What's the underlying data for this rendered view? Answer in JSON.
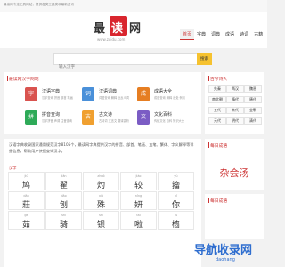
{
  "topbar": {
    "text": "最读网专注工具网站，提供各类工具类和最新资讯"
  },
  "logo": {
    "part1": "最",
    "part2": "读",
    "part3": "网",
    "url": "www.zuidu.com"
  },
  "nav": [
    "首页",
    "字典",
    "词典",
    "成语",
    "诗词",
    "古籍"
  ],
  "search": {
    "placeholder": "输入汉字",
    "button": "搜索"
  },
  "tools_panel": {
    "title": "最读网汉字网站",
    "items": [
      {
        "icon": "字",
        "name": "汉语字典",
        "desc": "汉字查询 拼音 部首 笔画",
        "color": "#d9534f"
      },
      {
        "icon": "词",
        "name": "汉语词典",
        "desc": "词语查询 解释 近反义词",
        "color": "#4a90d9"
      },
      {
        "icon": "成",
        "name": "成语大全",
        "desc": "成语查询 解释 出处 例句",
        "color": "#e67e22"
      },
      {
        "icon": "拼",
        "name": "拼音查询",
        "desc": "汉字拼音 声调 注音查询",
        "color": "#2eaa58"
      },
      {
        "icon": "古",
        "name": "古文诗",
        "desc": "古诗词 文言文 翻译赏析",
        "color": "#f0a030"
      },
      {
        "icon": "文",
        "name": "文化百科",
        "desc": "传统文化 百科 知识大全",
        "color": "#7b5cc4"
      }
    ]
  },
  "dynasty_panel": {
    "title": "古今诗人",
    "items": [
      "先秦",
      "两汉",
      "魏晋",
      "南北朝",
      "隋代",
      "唐代",
      "五代",
      "宋代",
      "金朝",
      "元代",
      "明代",
      "清代"
    ]
  },
  "dict_panel": {
    "desc": "汉语字典收录国家通用规范汉字8105个，最读网字典提供汉字的拼音、部首、笔画、五笔、繁体、字义解释等详细信息，帮助用户快速查询汉字。",
    "label": "汉字",
    "chars": [
      {
        "py": "jiǔ",
        "hz": "鸠"
      },
      {
        "py": "jiān",
        "hz": "翟"
      },
      {
        "py": "zhuó",
        "hz": "灼"
      },
      {
        "py": "jiào",
        "hz": "较"
      },
      {
        "py": "yù",
        "hz": "籀"
      },
      {
        "py": "dāo",
        "hz": "莊"
      },
      {
        "py": "dāo",
        "hz": "刨"
      },
      {
        "py": "xiá",
        "hz": "殊"
      },
      {
        "py": "nǐng",
        "hz": "妍"
      },
      {
        "py": "nǐ",
        "hz": "你"
      },
      {
        "py": "gè",
        "hz": "茹"
      },
      {
        "py": "shì",
        "hz": "骑"
      },
      {
        "py": "shǐ",
        "hz": "钡"
      },
      {
        "py": "tài",
        "hz": "啦"
      },
      {
        "py": "rú",
        "hz": "樯"
      }
    ]
  },
  "hot_panel": {
    "title": "每日成语",
    "word": "杂会汤"
  },
  "recent_panel": {
    "title": "每日成语"
  },
  "watermark": {
    "text": "导航收录网",
    "url": "daohang"
  }
}
